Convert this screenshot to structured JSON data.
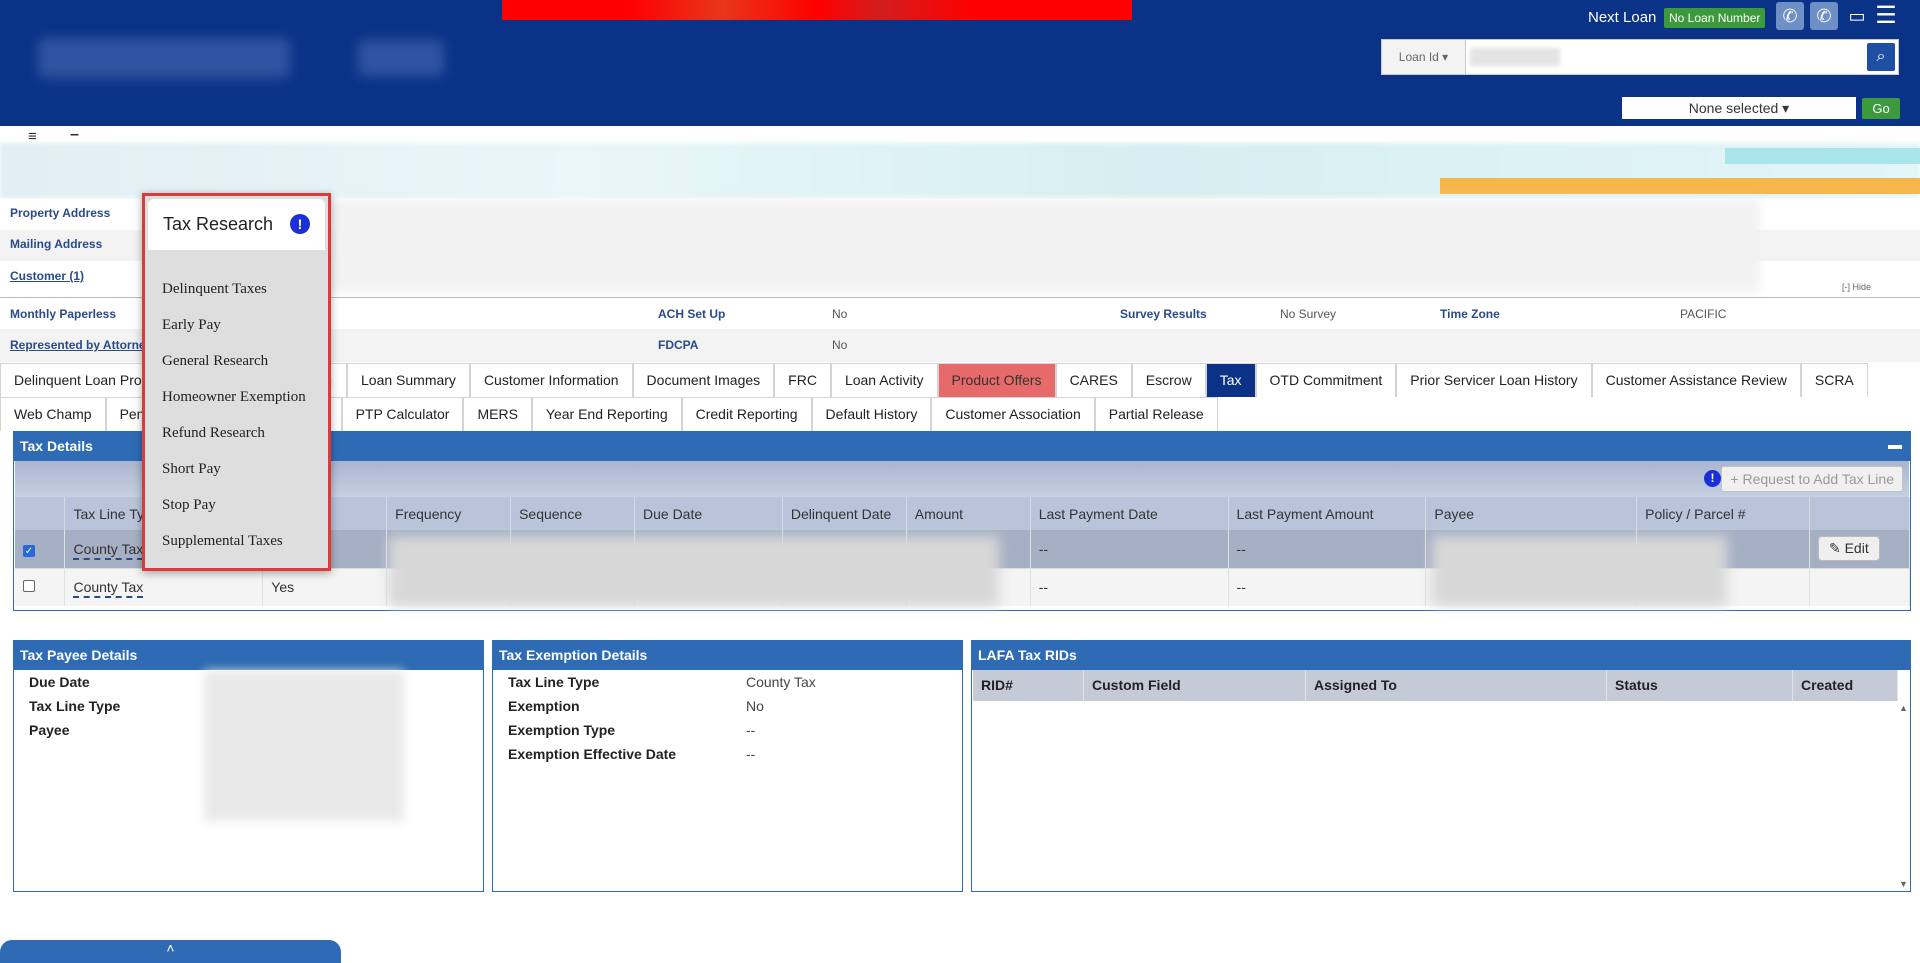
{
  "header": {
    "next_loan_label": "Next Loan",
    "no_loan_badge": "No Loan Number",
    "loan_id_select": "Loan Id ▾",
    "search_icon": "search-icon",
    "none_selected": "None selected ▾",
    "go_label": "Go",
    "phone_icon": "✆",
    "phone_icon_2": "✆",
    "monitor_icon": "▭",
    "menu_icon": "☰",
    "search_glyph": "⌕"
  },
  "toolbar": {
    "menu_toggle": "≡",
    "minus_toggle": "–"
  },
  "info": {
    "property_address": "Property Address",
    "mailing_address": "Mailing Address",
    "customer": "Customer (1)",
    "hide": "[-] Hide",
    "monthly_paperless": "Monthly Paperless",
    "represented_by": "Represented by Attorne",
    "ach_setup_label": "ACH Set Up",
    "ach_setup_value": "No",
    "fdcpa_label": "FDCPA",
    "fdcpa_value": "No",
    "survey_label": "Survey Results",
    "survey_value": "No Survey",
    "timezone_label": "Time Zone",
    "timezone_value": "PACIFIC"
  },
  "tabs_row1": [
    {
      "label": "Delinquent Loan Pro"
    },
    {
      "label": "g"
    },
    {
      "label": "Loan Summary"
    },
    {
      "label": "Customer Information"
    },
    {
      "label": "Document Images"
    },
    {
      "label": "FRC"
    },
    {
      "label": "Loan Activity"
    },
    {
      "label": "Product Offers"
    },
    {
      "label": "CARES"
    },
    {
      "label": "Escrow"
    },
    {
      "label": "Tax"
    },
    {
      "label": "OTD Commitment"
    },
    {
      "label": "Prior Servicer Loan History"
    },
    {
      "label": "Customer Assistance Review"
    },
    {
      "label": "SCRA"
    }
  ],
  "tabs_row2": [
    {
      "label": "Web Champ"
    },
    {
      "label": "Penn"
    },
    {
      "label": "PTP Calculator"
    },
    {
      "label": "MERS"
    },
    {
      "label": "Year End Reporting"
    },
    {
      "label": "Credit Reporting"
    },
    {
      "label": "Default History"
    },
    {
      "label": "Customer Association"
    },
    {
      "label": "Partial Release"
    }
  ],
  "tax_details": {
    "title": "Tax Details",
    "request_btn": "+ Request to Add Tax Line",
    "info_glyph": "!",
    "columns": [
      "Tax Line Typ",
      "ed",
      "Frequency",
      "Sequence",
      "Due Date",
      "Delinquent Date",
      "Amount",
      "Last Payment Date",
      "Last Payment Amount",
      "Payee",
      "Policy / Parcel #"
    ],
    "rows": [
      {
        "checked": true,
        "tax_line": "County Tax",
        "verified": "",
        "last_payment_date": "--",
        "last_payment_amount": "--",
        "edit": "✎ Edit"
      },
      {
        "checked": false,
        "tax_line": "County Tax",
        "verified": "Yes",
        "last_payment_date": "--",
        "last_payment_amount": "--"
      }
    ]
  },
  "payee_details": {
    "title": "Tax Payee Details",
    "due_date": "Due Date",
    "tax_line_type": "Tax Line Type",
    "payee": "Payee"
  },
  "exemption_details": {
    "title": "Tax Exemption Details",
    "tax_line_type_k": "Tax Line Type",
    "tax_line_type_v": "County Tax",
    "exemption_k": "Exemption",
    "exemption_v": "No",
    "exemption_type_k": "Exemption Type",
    "exemption_type_v": "--",
    "effective_date_k": "Exemption Effective Date",
    "effective_date_v": "--"
  },
  "lafa": {
    "title": "LAFA Tax RIDs",
    "columns": [
      "RID#",
      "Custom Field",
      "Assigned To",
      "Status",
      "Created"
    ]
  },
  "popup": {
    "title": "Tax Research",
    "info_glyph": "!",
    "items": [
      "Delinquent Taxes",
      "Early Pay",
      "General Research",
      "Homeowner Exemption",
      "Refund Research",
      "Short Pay",
      "Stop Pay",
      "Supplemental Taxes"
    ]
  },
  "bottom_tab": {
    "glyph": "˄"
  },
  "colors": {
    "header_bg": "#0a3287",
    "panel_blue": "#2f6bb4",
    "active_tab": "#0b3286",
    "product_offers_tab": "#e76a6a",
    "popup_border": "#d93a3a",
    "go_green": "#3c9a3c"
  }
}
